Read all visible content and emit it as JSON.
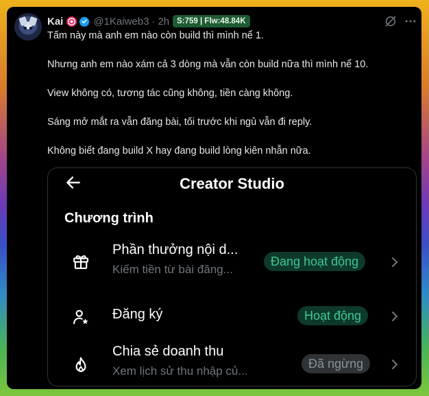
{
  "author": {
    "name": "Kai",
    "handle": "@1Kaiweb3",
    "time": "2h",
    "stats_badge": "S:759 | Flw:48.84K",
    "badge_icons": [
      "target-icon",
      "verified-icon"
    ]
  },
  "header_icons": [
    "grok-icon",
    "more-icon"
  ],
  "tweet_lines": [
    "Tấm này mà anh em nào còn build thì mình nể 1.",
    "Nhưng anh em nào xám cả 3 dòng mà vẫn còn build nữa thì mình nể 10.",
    "View không có, tương tác cũng không, tiền càng không.",
    "Sáng mở mắt ra vẫn đăng bài, tối trước khi ngủ vẫn đi reply.",
    "Không biết đang build X hay đang build lòng kiên nhẫn nữa."
  ],
  "studio": {
    "title": "Creator Studio",
    "section": "Chương trình",
    "rows": [
      {
        "icon": "gift-icon",
        "title": "Phần thưởng nội d...",
        "subtitle": "Kiếm tiền từ bài đăng...",
        "status": "Đang hoạt động",
        "status_kind": "active"
      },
      {
        "icon": "user-star-icon",
        "title": "Đăng ký",
        "subtitle": "",
        "status": "Hoạt động",
        "status_kind": "active"
      },
      {
        "icon": "flame-icon",
        "title": "Chia sẻ doanh thu",
        "subtitle": "Xem lịch sử thu nhập củ...",
        "status": "Đã ngừng",
        "status_kind": "paused"
      }
    ]
  },
  "colors": {
    "background": "#000000",
    "text": "#e7e9ea",
    "muted": "#71767b",
    "badge_bg": "#1f5b32",
    "active_pill_bg": "#0d3a2b",
    "active_pill_text": "#3fc793",
    "paused_pill_bg": "#2f3336",
    "paused_pill_text": "#8b9096",
    "verified": "#1d9bf0",
    "target": "#e0245e"
  }
}
